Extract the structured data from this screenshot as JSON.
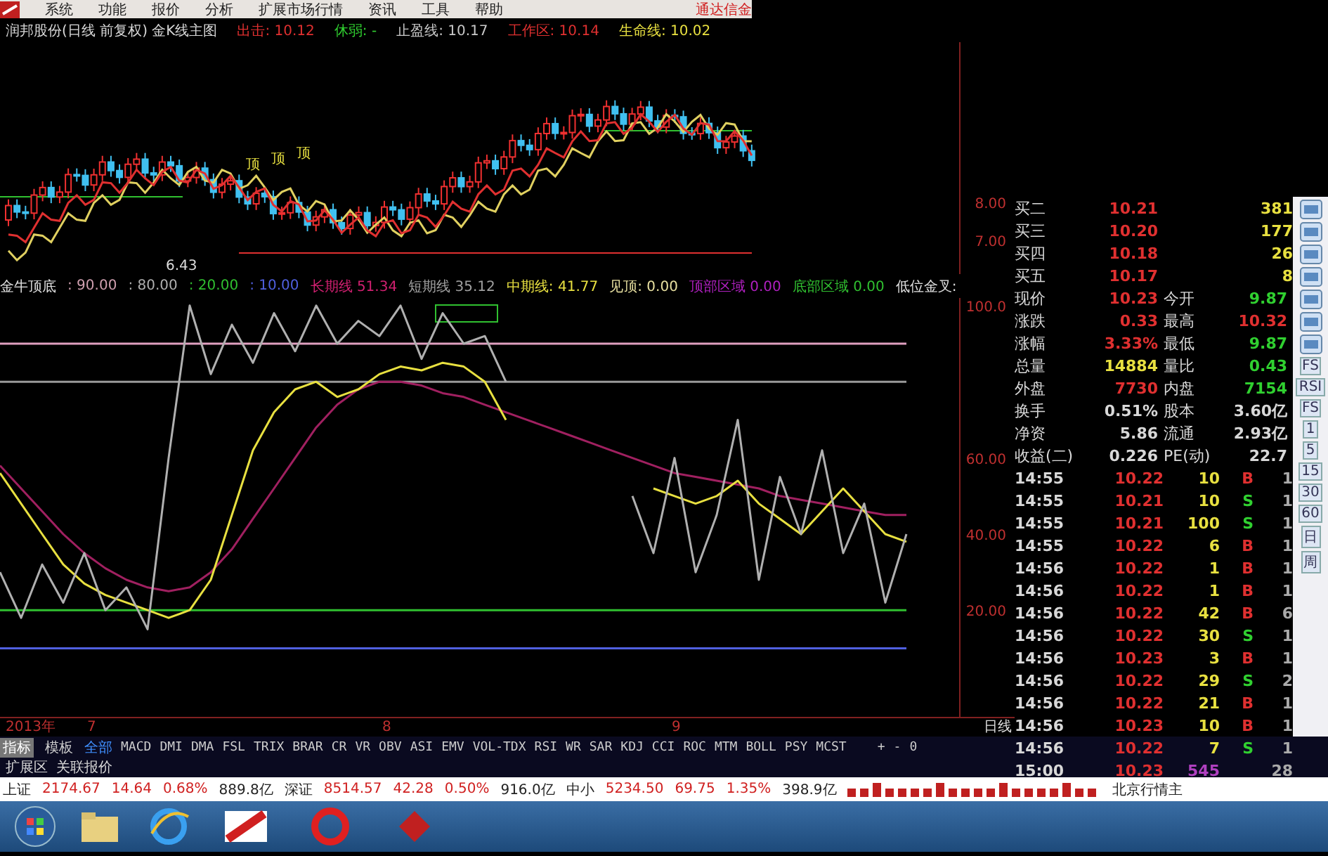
{
  "menu": {
    "items": [
      "系统",
      "功能",
      "报价",
      "分析",
      "扩展市场行情",
      "资讯",
      "工具",
      "帮助"
    ],
    "brand": "通达信金"
  },
  "title_row": [
    {
      "text": "润邦股份(日线 前复权) 金K线主图",
      "color": "#d8d8d8"
    },
    {
      "text": "出击: 10.12",
      "color": "#e03030"
    },
    {
      "text": "休弱: -",
      "color": "#30d030"
    },
    {
      "text": "止盈线: 10.17",
      "color": "#c8c8c8"
    },
    {
      "text": "工作区: 10.14",
      "color": "#e03030"
    },
    {
      "text": "生命线: 10.02",
      "color": "#e8e040"
    }
  ],
  "candle_chart": {
    "axis_labels": [
      "8.00",
      "7.00"
    ],
    "marks": [
      "顶",
      "顶",
      "顶"
    ],
    "low_label": "6.43"
  },
  "indicator_header": [
    {
      "label": "金牛顶底",
      "color": "#e0e0e0"
    },
    {
      "value": ": 90.00",
      "color": "#d0a0b0"
    },
    {
      "value": ": 80.00",
      "color": "#b0b0b0"
    },
    {
      "value": ": 20.00",
      "color": "#30c030"
    },
    {
      "value": ": 10.00",
      "color": "#5060e0"
    },
    {
      "label": "长期线",
      "value": "51.34",
      "color": "#d02070"
    },
    {
      "label": "短期线",
      "value": "35.12",
      "color": "#a0a0a0"
    },
    {
      "label": "中期线:",
      "value": "41.77",
      "color": "#e8e040"
    },
    {
      "label": "见顶:",
      "value": "0.00",
      "color": "#e8e0a0"
    },
    {
      "label": "顶部区域",
      "value": "0.00",
      "color": "#b020c0"
    },
    {
      "label": "底部区域",
      "value": "0.00",
      "color": "#30c030"
    },
    {
      "label": "低位金叉:",
      "color": "#e0e0e0"
    }
  ],
  "indicator_chart": {
    "chart_data": {
      "type": "line",
      "ylim": [
        -8,
        102
      ],
      "yticks": [
        {
          "value": 100,
          "label": "100.0"
        },
        {
          "value": 60,
          "label": "60.00"
        },
        {
          "value": 40,
          "label": "40.00"
        },
        {
          "value": 20,
          "label": "20.00"
        }
      ],
      "series": [
        {
          "color": "#e0a0c0",
          "values": [
            90,
            90,
            90,
            90,
            90,
            90,
            90,
            90,
            90,
            90,
            90,
            90,
            90,
            90,
            90,
            90,
            90,
            90,
            90,
            90,
            90,
            90,
            90,
            90,
            90,
            90,
            90,
            90,
            90,
            90,
            90,
            90,
            90,
            90,
            90,
            90,
            90,
            90,
            90,
            90,
            90,
            90,
            90,
            90
          ]
        },
        {
          "color": "#999999",
          "values": [
            80,
            80,
            80,
            80,
            80,
            80,
            80,
            80,
            80,
            80,
            80,
            80,
            80,
            80,
            80,
            80,
            80,
            80,
            80,
            80,
            80,
            80,
            80,
            80,
            80,
            80,
            80,
            80,
            80,
            80,
            80,
            80,
            80,
            80,
            80,
            80,
            80,
            80,
            80,
            80,
            80,
            80,
            80,
            80
          ]
        },
        {
          "color": "#30c030",
          "values": [
            20,
            20,
            20,
            20,
            20,
            20,
            20,
            20,
            20,
            20,
            20,
            20,
            20,
            20,
            20,
            20,
            20,
            20,
            20,
            20,
            20,
            20,
            20,
            20,
            20,
            20,
            20,
            20,
            20,
            20,
            20,
            20,
            20,
            20,
            20,
            20,
            20,
            20,
            20,
            20,
            20,
            20,
            20,
            20
          ]
        },
        {
          "color": "#5060e0",
          "values": [
            10,
            10,
            10,
            10,
            10,
            10,
            10,
            10,
            10,
            10,
            10,
            10,
            10,
            10,
            10,
            10,
            10,
            10,
            10,
            10,
            10,
            10,
            10,
            10,
            10,
            10,
            10,
            10,
            10,
            10,
            10,
            10,
            10,
            10,
            10,
            10,
            10,
            10,
            10,
            10,
            10,
            10,
            10,
            10
          ]
        },
        {
          "color": "#a02060",
          "values": [
            58,
            52,
            46,
            40,
            35,
            31,
            28,
            26,
            25,
            26,
            30,
            36,
            44,
            52,
            60,
            68,
            74,
            78,
            80,
            80,
            79,
            77,
            76,
            74,
            72,
            70,
            68,
            66,
            64,
            62,
            60,
            58,
            56,
            55,
            54,
            53,
            52,
            50,
            49,
            48,
            47,
            46,
            45,
            45
          ]
        },
        {
          "color": "#e8e040",
          "values": [
            56,
            48,
            40,
            32,
            27,
            24,
            22,
            20,
            18,
            20,
            28,
            45,
            62,
            72,
            78,
            80,
            76,
            78,
            82,
            84,
            83,
            85,
            84,
            80,
            70,
            null,
            null,
            null,
            null,
            null,
            null,
            52,
            50,
            48,
            50,
            54,
            48,
            44,
            40,
            46,
            52,
            46,
            40,
            38
          ]
        },
        {
          "color": "#b0b0b0",
          "values": [
            30,
            18,
            32,
            22,
            35,
            20,
            26,
            15,
            60,
            100,
            82,
            95,
            85,
            98,
            88,
            100,
            90,
            96,
            92,
            100,
            86,
            98,
            90,
            92,
            80,
            null,
            null,
            null,
            null,
            null,
            50,
            35,
            60,
            30,
            45,
            70,
            28,
            55,
            40,
            62,
            35,
            48,
            22,
            40
          ]
        }
      ]
    }
  },
  "x_axis": [
    "2013年",
    "7",
    "8",
    "9"
  ],
  "period_label": "日线",
  "zoom_controls": [
    "+",
    "-",
    "0"
  ],
  "quote": {
    "bids": [
      {
        "label": "买二",
        "price": "10.21",
        "volume": "381"
      },
      {
        "label": "买三",
        "price": "10.20",
        "volume": "177"
      },
      {
        "label": "买四",
        "price": "10.18",
        "volume": "26"
      },
      {
        "label": "买五",
        "price": "10.17",
        "volume": "8"
      }
    ],
    "stats": [
      {
        "left": {
          "label": "现价",
          "value": "10.23",
          "color": "#e03030"
        },
        "right": {
          "label": "今开",
          "value": "9.87",
          "color": "#30d030"
        }
      },
      {
        "left": {
          "label": "涨跌",
          "value": "0.33",
          "color": "#e03030"
        },
        "right": {
          "label": "最高",
          "value": "10.32",
          "color": "#e03030"
        }
      },
      {
        "left": {
          "label": "涨幅",
          "value": "3.33%",
          "color": "#e03030"
        },
        "right": {
          "label": "最低",
          "value": "9.87",
          "color": "#30d030"
        }
      },
      {
        "left": {
          "label": "总量",
          "value": "14884",
          "color": "#e8e040"
        },
        "right": {
          "label": "量比",
          "value": "0.43",
          "color": "#30d030"
        }
      },
      {
        "left": {
          "label": "外盘",
          "value": "7730",
          "color": "#e03030"
        },
        "right": {
          "label": "内盘",
          "value": "7154",
          "color": "#30d030"
        }
      },
      {
        "left": {
          "label": "换手",
          "value": "0.51%",
          "color": "#d8d8d8"
        },
        "right": {
          "label": "股本",
          "value": "3.60亿",
          "color": "#d8d8d8"
        }
      },
      {
        "left": {
          "label": "净资",
          "value": "5.86",
          "color": "#d8d8d8"
        },
        "right": {
          "label": "流通",
          "value": "2.93亿",
          "color": "#d8d8d8"
        }
      },
      {
        "left": {
          "label": "收益(二)",
          "value": "0.226",
          "color": "#d8d8d8"
        },
        "right": {
          "label": "PE(动)",
          "value": "22.7",
          "color": "#d8d8d8"
        }
      }
    ],
    "ticks": [
      {
        "time": "14:55",
        "price": "10.22",
        "volume": "10",
        "side": "B",
        "kind": "buy",
        "count": "1"
      },
      {
        "time": "14:55",
        "price": "10.21",
        "volume": "10",
        "side": "S",
        "kind": "sell",
        "count": "1"
      },
      {
        "time": "14:55",
        "price": "10.21",
        "volume": "100",
        "side": "S",
        "kind": "sell",
        "count": "1"
      },
      {
        "time": "14:55",
        "price": "10.22",
        "volume": "6",
        "side": "B",
        "kind": "buy",
        "count": "1"
      },
      {
        "time": "14:56",
        "price": "10.22",
        "volume": "1",
        "side": "B",
        "kind": "buy",
        "count": "1"
      },
      {
        "time": "14:56",
        "price": "10.22",
        "volume": "1",
        "side": "B",
        "kind": "buy",
        "count": "1"
      },
      {
        "time": "14:56",
        "price": "10.22",
        "volume": "42",
        "side": "B",
        "kind": "buy",
        "count": "6"
      },
      {
        "time": "14:56",
        "price": "10.22",
        "volume": "30",
        "side": "S",
        "kind": "sell",
        "count": "1"
      },
      {
        "time": "14:56",
        "price": "10.23",
        "volume": "3",
        "side": "B",
        "kind": "buy",
        "count": "1"
      },
      {
        "time": "14:56",
        "price": "10.22",
        "volume": "29",
        "side": "S",
        "kind": "sell",
        "count": "2"
      },
      {
        "time": "14:56",
        "price": "10.22",
        "volume": "21",
        "side": "B",
        "kind": "buy",
        "count": "1"
      },
      {
        "time": "14:56",
        "price": "10.23",
        "volume": "10",
        "side": "B",
        "kind": "buy",
        "count": "1"
      },
      {
        "time": "14:56",
        "price": "10.22",
        "volume": "7",
        "side": "S",
        "kind": "sell",
        "count": "1"
      },
      {
        "time": "15:00",
        "price": "10.23",
        "volume": "545",
        "kind": "close",
        "count": "28"
      }
    ]
  },
  "toolbar_labels": [
    "FS",
    "RSI",
    "FS",
    "1",
    "5",
    "15",
    "30",
    "60",
    "日",
    "周"
  ],
  "panel_tabs": [
    {
      "label": "指标",
      "selected": true
    },
    {
      "label": "模板",
      "selected": false
    }
  ],
  "indicators": [
    {
      "label": "全部",
      "selected": true
    },
    {
      "label": "MACD",
      "selected": false
    },
    {
      "label": "DMI",
      "selected": false
    },
    {
      "label": "DMA",
      "selected": false
    },
    {
      "label": "FSL",
      "selected": false
    },
    {
      "label": "TRIX",
      "selected": false
    },
    {
      "label": "BRAR",
      "selected": false
    },
    {
      "label": "CR",
      "selected": false
    },
    {
      "label": "VR",
      "selected": false
    },
    {
      "label": "OBV",
      "selected": false
    },
    {
      "label": "ASI",
      "selected": false
    },
    {
      "label": "EMV",
      "selected": false
    },
    {
      "label": "VOL-TDX",
      "selected": false
    },
    {
      "label": "RSI",
      "selected": false
    },
    {
      "label": "WR",
      "selected": false
    },
    {
      "label": "SAR",
      "selected": false
    },
    {
      "label": "KDJ",
      "selected": false
    },
    {
      "label": "CCI",
      "selected": false
    },
    {
      "label": "ROC",
      "selected": false
    },
    {
      "label": "MTM",
      "selected": false
    },
    {
      "label": "BOLL",
      "selected": false
    },
    {
      "label": "PSY",
      "selected": false
    },
    {
      "label": "MCST",
      "selected": false
    }
  ],
  "extra_tabs": [
    "扩展区",
    "关联报价"
  ],
  "index_bar": [
    {
      "name": "上证",
      "value": "2174.67",
      "change": "14.64",
      "pct": "0.68%",
      "amount": "889.8亿"
    },
    {
      "name": "深证",
      "value": "8514.57",
      "change": "42.28",
      "pct": "0.50%",
      "amount": "916.0亿"
    },
    {
      "name": "中小",
      "value": "5234.50",
      "change": "69.75",
      "pct": "1.35%",
      "amount": "398.9亿"
    }
  ],
  "index_bar_tail": "北京行情主"
}
